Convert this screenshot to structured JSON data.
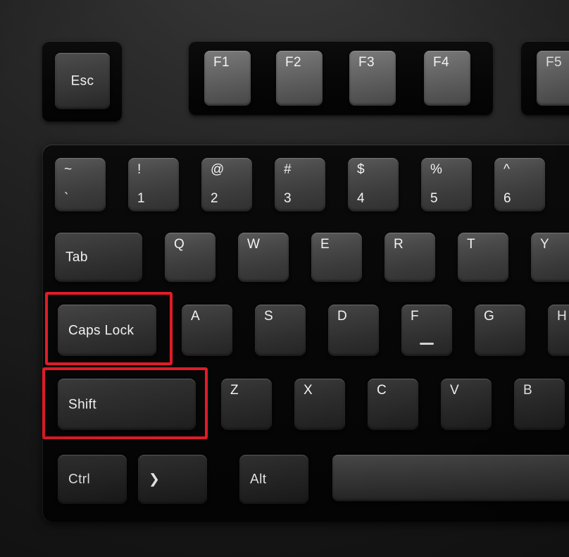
{
  "theme": {
    "highlight_color": "#e01c28",
    "keycap_text_color": "#f2f2f2",
    "board_color": "#060606",
    "background_color": "#202020"
  },
  "keyboard": {
    "description": "Close-up photo of the left portion of a black mechanical keyboard",
    "esc_key": {
      "label": "Esc"
    },
    "function_keys": [
      {
        "label": "F1"
      },
      {
        "label": "F2"
      },
      {
        "label": "F3"
      },
      {
        "label": "F4"
      },
      {
        "label": "F5"
      }
    ],
    "number_row": [
      {
        "shift_label": "~",
        "base_label": "`"
      },
      {
        "shift_label": "!",
        "base_label": "1"
      },
      {
        "shift_label": "@",
        "base_label": "2"
      },
      {
        "shift_label": "#",
        "base_label": "3"
      },
      {
        "shift_label": "$",
        "base_label": "4"
      },
      {
        "shift_label": "%",
        "base_label": "5"
      },
      {
        "shift_label": "^",
        "base_label": "6"
      }
    ],
    "tab_row": [
      {
        "label": "Tab"
      },
      {
        "label": "Q"
      },
      {
        "label": "W"
      },
      {
        "label": "E"
      },
      {
        "label": "R"
      },
      {
        "label": "T"
      },
      {
        "label": "Y"
      }
    ],
    "home_row": [
      {
        "label": "Caps Lock"
      },
      {
        "label": "A"
      },
      {
        "label": "S"
      },
      {
        "label": "D"
      },
      {
        "label": "F"
      },
      {
        "label": "G"
      },
      {
        "label": "H"
      }
    ],
    "bottom_letter_row": [
      {
        "label": "Shift"
      },
      {
        "label": "Z"
      },
      {
        "label": "X"
      },
      {
        "label": "C"
      },
      {
        "label": "V"
      },
      {
        "label": "B"
      }
    ],
    "modifier_row": [
      {
        "label": "Ctrl"
      },
      {
        "label": "❯"
      },
      {
        "label": "Alt"
      },
      {
        "label": ""
      }
    ]
  },
  "annotations": [
    {
      "target": "Caps Lock",
      "color": "#e01c28"
    },
    {
      "target": "Shift",
      "color": "#e01c28"
    }
  ]
}
